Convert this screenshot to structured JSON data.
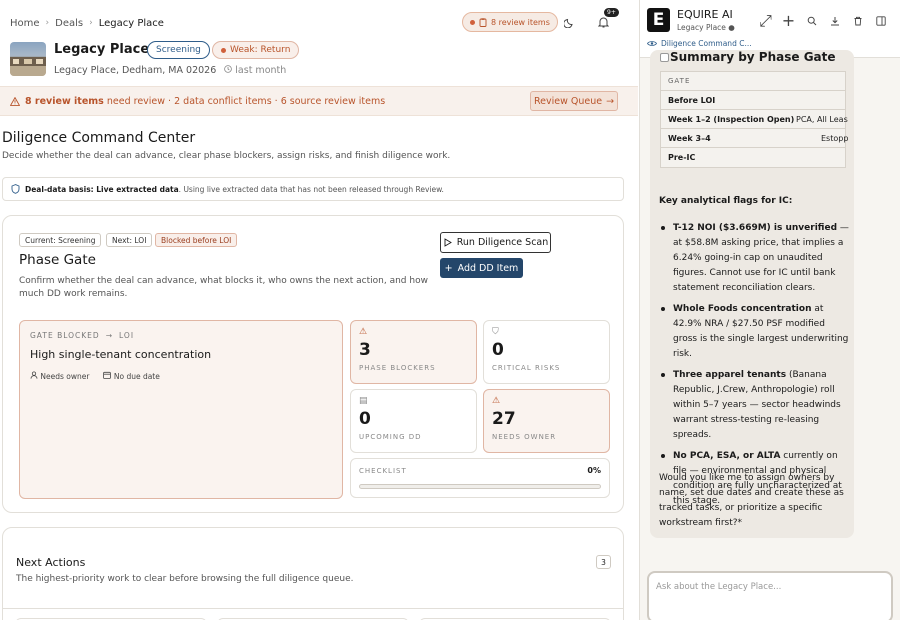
{
  "breadcrumb": {
    "home": "Home",
    "deals": "Deals",
    "current": "Legacy Place"
  },
  "header": {
    "review_items": "8 review items",
    "notif_badge": "9+"
  },
  "property": {
    "name": "Legacy Place",
    "stage_tag": "Screening",
    "rating_tag": "Weak: Return",
    "address": "Legacy Place, Dedham, MA 02026",
    "updated": "last month"
  },
  "alert": {
    "count_label": "8 review items",
    "rest": "need review · 2 data conflict items · 6 source review items",
    "button": "Review Queue"
  },
  "page": {
    "title": "Diligence Command Center",
    "subtitle": "Decide whether the deal can advance, clear phase blockers, assign risks, and finish diligence work."
  },
  "basis": {
    "label": "Deal-data basis: Live extracted data",
    "text": ". Using live extracted data that has not been released through Review."
  },
  "phase_gate": {
    "chip_current": "Current: Screening",
    "chip_next": "Next: LOI",
    "chip_blocked": "Blocked before LOI",
    "title": "Phase Gate",
    "description": "Confirm whether the deal can advance, what blocks it, who owns the next action, and how much DD work remains.",
    "scan_button": "Run Diligence Scan",
    "add_button": "Add DD Item",
    "gate_label": "GATE BLOCKED",
    "gate_target": "LOI",
    "gate_headline": "High single-tenant concentration",
    "owner": "Needs owner",
    "due": "No due date",
    "stats": [
      {
        "num": "3",
        "label": "PHASE BLOCKERS"
      },
      {
        "num": "0",
        "label": "CRITICAL RISKS"
      },
      {
        "num": "0",
        "label": "UPCOMING DD"
      },
      {
        "num": "27",
        "label": "NEEDS OWNER"
      }
    ],
    "checklist_label": "CHECKLIST",
    "checklist_pct": "0%",
    "checklist_value": 0
  },
  "next_actions": {
    "title": "Next Actions",
    "subtitle": "The highest-priority work to clear before browsing the full diligence queue.",
    "count": "3"
  },
  "assistant": {
    "title": "EQUIRE AI",
    "subtitle": "Legacy Place",
    "logo": "E",
    "link": "Diligence Command C...",
    "summary_title": "Summary by Phase Gate",
    "table_header": "GATE",
    "gates": [
      {
        "name": "Before LOI",
        "value": ""
      },
      {
        "name": "Week 1–2 (Inspection Open)",
        "value": "PCA, All Leas"
      },
      {
        "name": "Week 3–4",
        "value": "Estopp"
      },
      {
        "name": "Pre-IC",
        "value": ""
      }
    ],
    "flags_heading": "Key analytical flags for IC:",
    "flags": [
      {
        "bold": "T-12 NOI ($3.669M) is unverified",
        "text": " — at $58.8M asking price, that implies a 6.24% going-in cap on unaudited figures. Cannot use for IC until bank statement reconciliation clears."
      },
      {
        "bold": "Whole Foods concentration",
        "text": " at 42.9% NRA / $27.50 PSF modified gross is the single largest underwriting risk."
      },
      {
        "bold": "Three apparel tenants",
        "text": " (Banana Republic, J.Crew, Anthropologie) roll within 5–7 years — sector headwinds warrant stress-testing re-leasing spreads."
      },
      {
        "bold": "No PCA, ESA, or ALTA",
        "text": " currently on file — environmental and physical condition are fully uncharacterized at this stage."
      }
    ],
    "follow_up": "Would you like me to assign owners by name, set due dates and create these as tracked tasks, or prioritize a specific workstream first?*",
    "input_placeholder": "Ask about the Legacy Place..."
  }
}
